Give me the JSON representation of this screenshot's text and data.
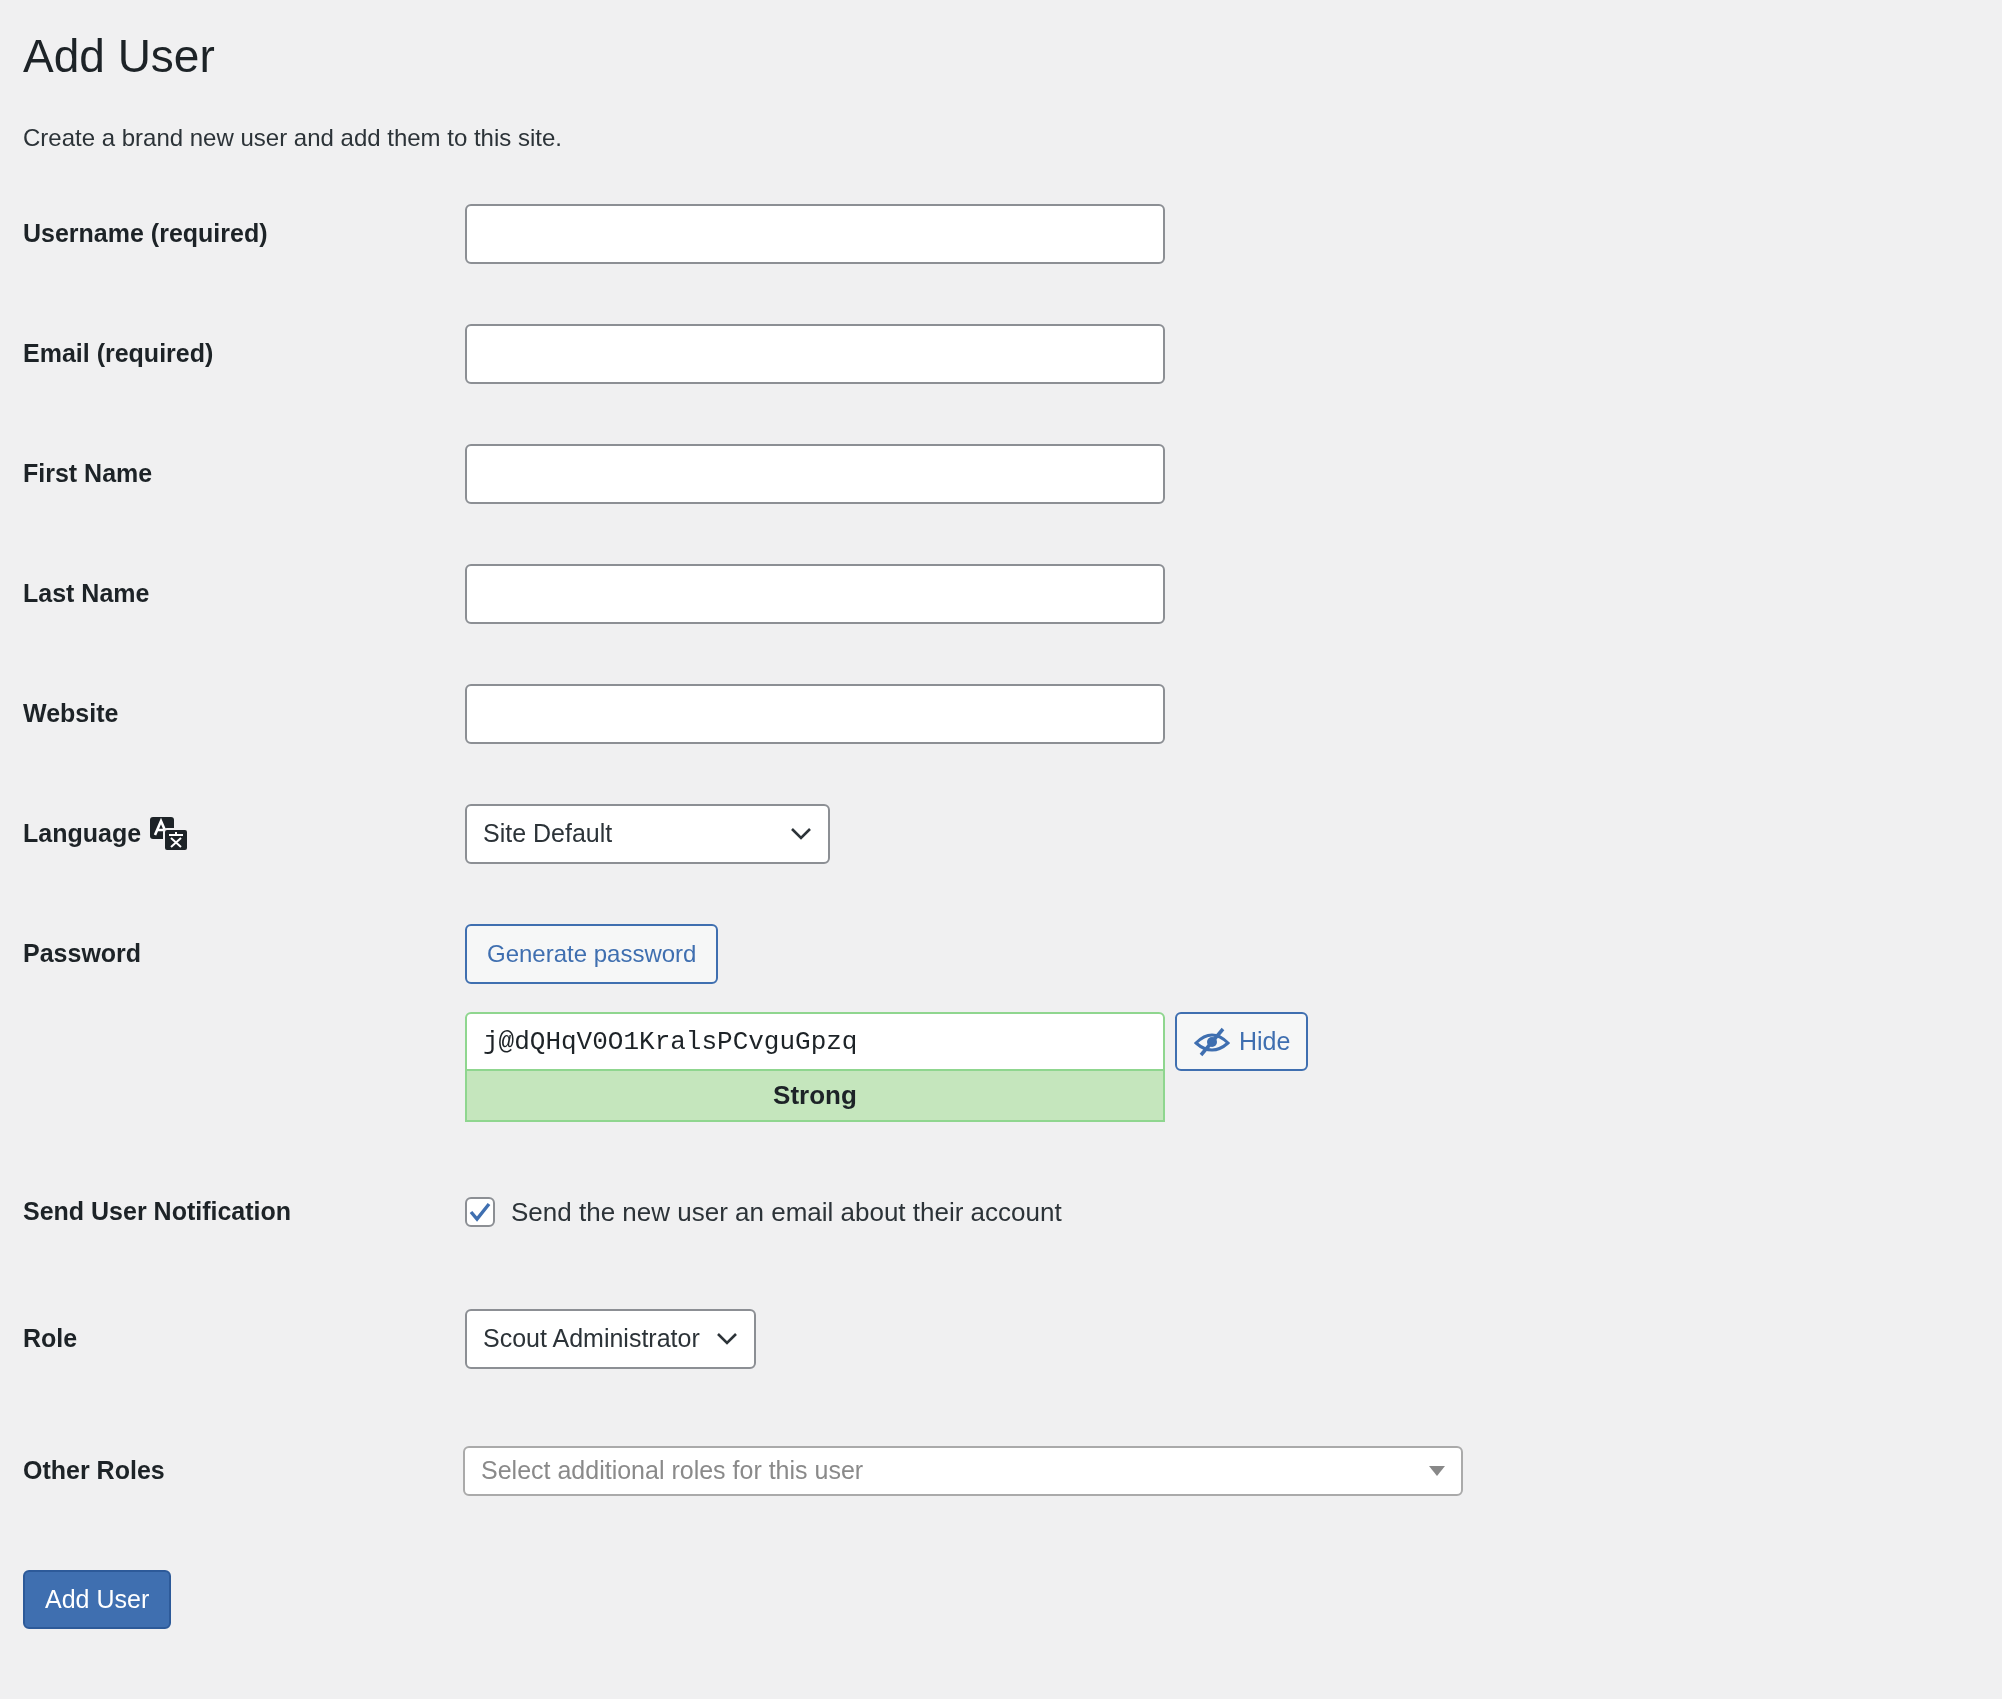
{
  "page": {
    "title": "Add User",
    "description": "Create a brand new user and add them to this site."
  },
  "fields": [
    {
      "kind": "text",
      "label": "Username (required)"
    },
    {
      "kind": "text",
      "label": "Email (required)"
    },
    {
      "kind": "text",
      "label": "First Name"
    },
    {
      "kind": "text",
      "label": "Last Name"
    },
    {
      "kind": "text",
      "label": "Website"
    },
    {
      "kind": "select",
      "label": "Language",
      "translate_icon": true,
      "value": "Site Default"
    },
    {
      "kind": "password",
      "label": "Password",
      "generate": "Generate password",
      "value": "j@dQHqV0O1KralsPCvguGpzq",
      "toggle": "Hide",
      "strength": "Strong"
    },
    {
      "kind": "checkbox",
      "label": "Send User Notification",
      "text": "Send the new user an email about their account",
      "checked": true
    },
    {
      "kind": "select",
      "label": "Role",
      "value": "Scout Administrator"
    },
    {
      "kind": "multiselect",
      "label": "Other Roles",
      "placeholder": "Select additional roles for this user"
    }
  ],
  "submit": "Add User"
}
